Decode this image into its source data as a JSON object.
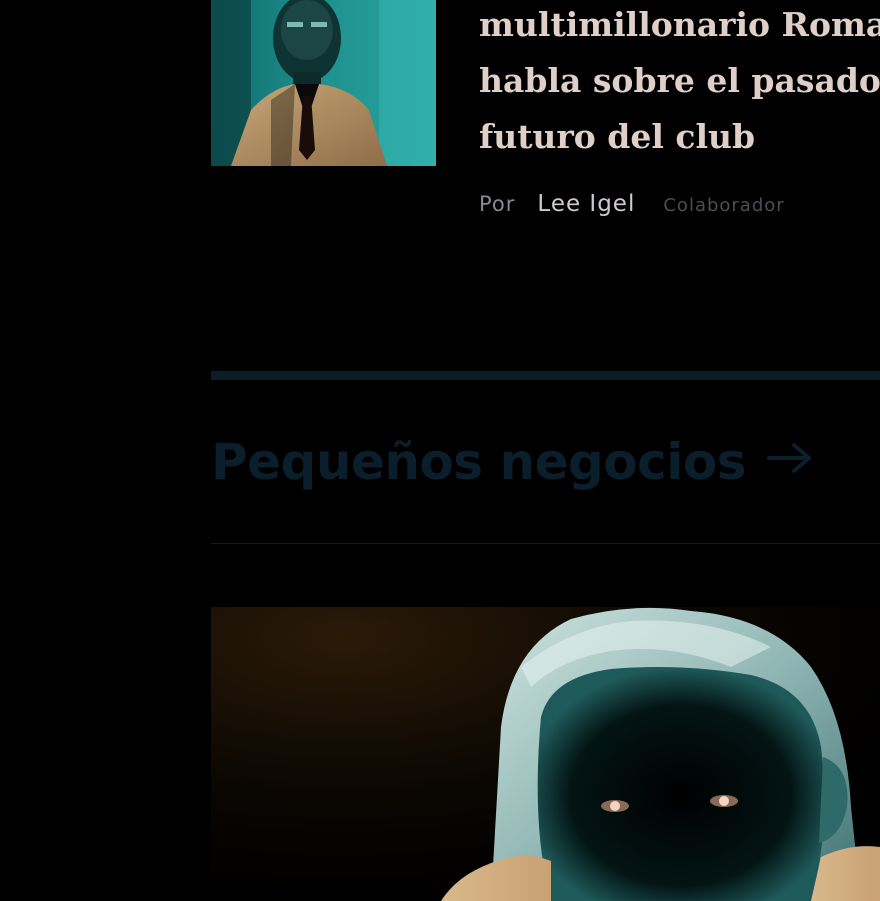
{
  "article": {
    "headline_lines": [
      "multimillonario Roma",
      "habla sobre el pasado,",
      "futuro del club"
    ],
    "byline": {
      "prefix": "Por",
      "author": "Lee Igel",
      "role": "Colaborador"
    },
    "thumbnail_icon": "portrait-photo"
  },
  "section": {
    "title": "Pequeños negocios",
    "arrow_icon": "arrow-right-icon",
    "accent_color": "#0b1e2c"
  },
  "feature": {
    "image_icon": "child-portrait-photo"
  }
}
